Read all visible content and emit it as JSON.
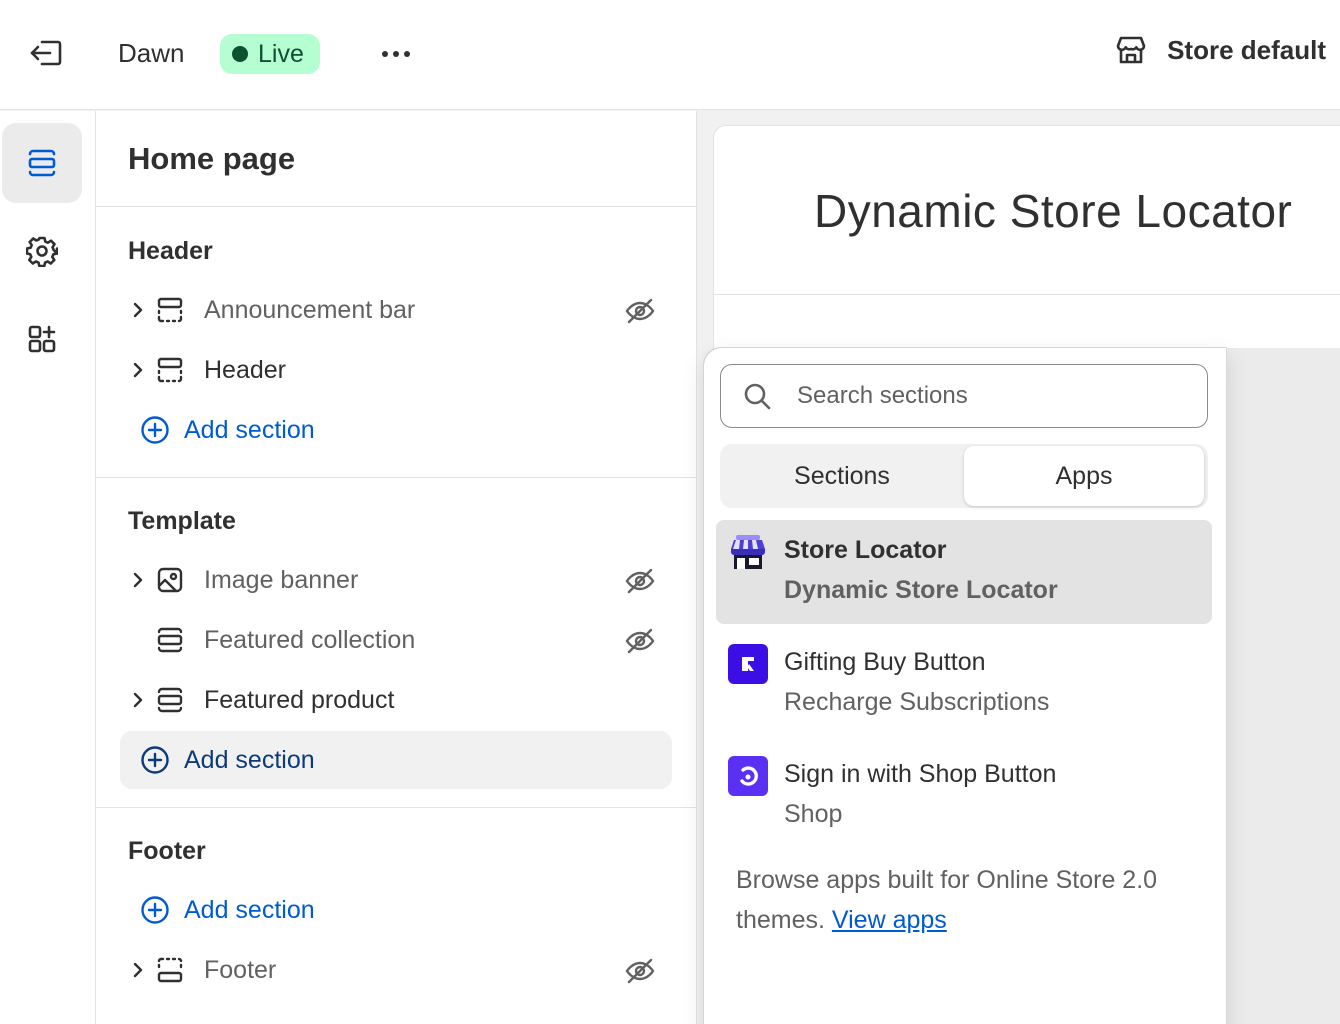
{
  "topbar": {
    "theme_name": "Dawn",
    "status_label": "Live",
    "store_label": "Store default"
  },
  "sidebar": {
    "page_title": "Home page",
    "groups": {
      "header": {
        "title": "Header",
        "items": [
          "Announcement bar",
          "Header"
        ],
        "add_label": "Add section"
      },
      "template": {
        "title": "Template",
        "items": [
          "Image banner",
          "Featured collection",
          "Featured product"
        ],
        "add_label": "Add section"
      },
      "footer": {
        "title": "Footer",
        "add_label": "Add section",
        "items": [
          "Footer"
        ]
      }
    }
  },
  "preview": {
    "title": "Dynamic Store Locator"
  },
  "popover": {
    "search_placeholder": "Search sections",
    "tabs": [
      "Sections",
      "Apps"
    ],
    "active_tab": "Apps",
    "apps": [
      {
        "name": "Store Locator",
        "provider": "Dynamic Store Locator"
      },
      {
        "name": "Gifting Buy Button",
        "provider": "Recharge Subscriptions"
      },
      {
        "name": "Sign in with Shop Button",
        "provider": "Shop"
      }
    ],
    "browse_text": "Browse apps built for Online Store 2.0 themes.",
    "browse_link": "View apps"
  },
  "colors": {
    "accent": "#005bd3",
    "live_bg": "#b4fed2",
    "live_text": "#0c5132",
    "recharge": "#3b0ee6",
    "shop": "#5a31f4"
  }
}
